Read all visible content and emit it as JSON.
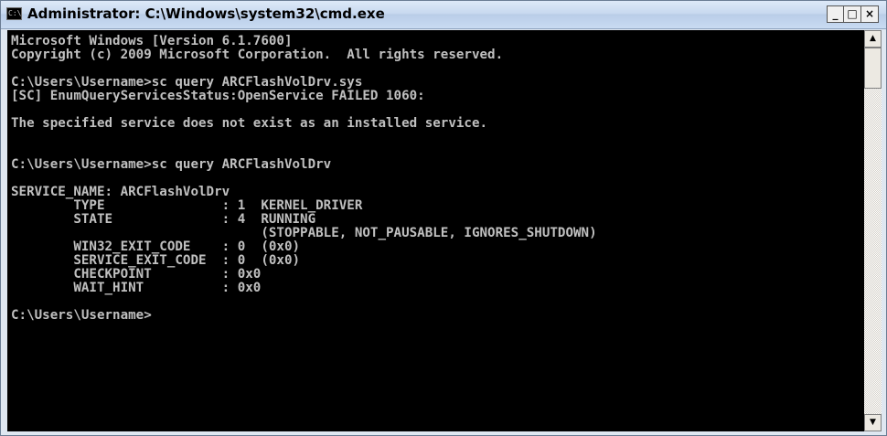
{
  "window": {
    "title": "Administrator: C:\\Windows\\system32\\cmd.exe",
    "icon_label": "C:\\",
    "buttons": {
      "minimize": "_",
      "maximize": "□",
      "close": "×"
    }
  },
  "console": {
    "lines": [
      "Microsoft Windows [Version 6.1.7600]",
      "Copyright (c) 2009 Microsoft Corporation.  All rights reserved.",
      "",
      "C:\\Users\\Username>sc query ARCFlashVolDrv.sys",
      "[SC] EnumQueryServicesStatus:OpenService FAILED 1060:",
      "",
      "The specified service does not exist as an installed service.",
      "",
      "",
      "C:\\Users\\Username>sc query ARCFlashVolDrv",
      "",
      "SERVICE_NAME: ARCFlashVolDrv",
      "        TYPE               : 1  KERNEL_DRIVER",
      "        STATE              : 4  RUNNING",
      "                                (STOPPABLE, NOT_PAUSABLE, IGNORES_SHUTDOWN)",
      "        WIN32_EXIT_CODE    : 0  (0x0)",
      "        SERVICE_EXIT_CODE  : 0  (0x0)",
      "        CHECKPOINT         : 0x0",
      "        WAIT_HINT          : 0x0",
      "",
      "C:\\Users\\Username>"
    ]
  },
  "scrollbar": {
    "up_arrow": "▲",
    "down_arrow": "▼"
  },
  "colors": {
    "console_bg": "#000000",
    "console_fg": "#c0c0c0"
  }
}
